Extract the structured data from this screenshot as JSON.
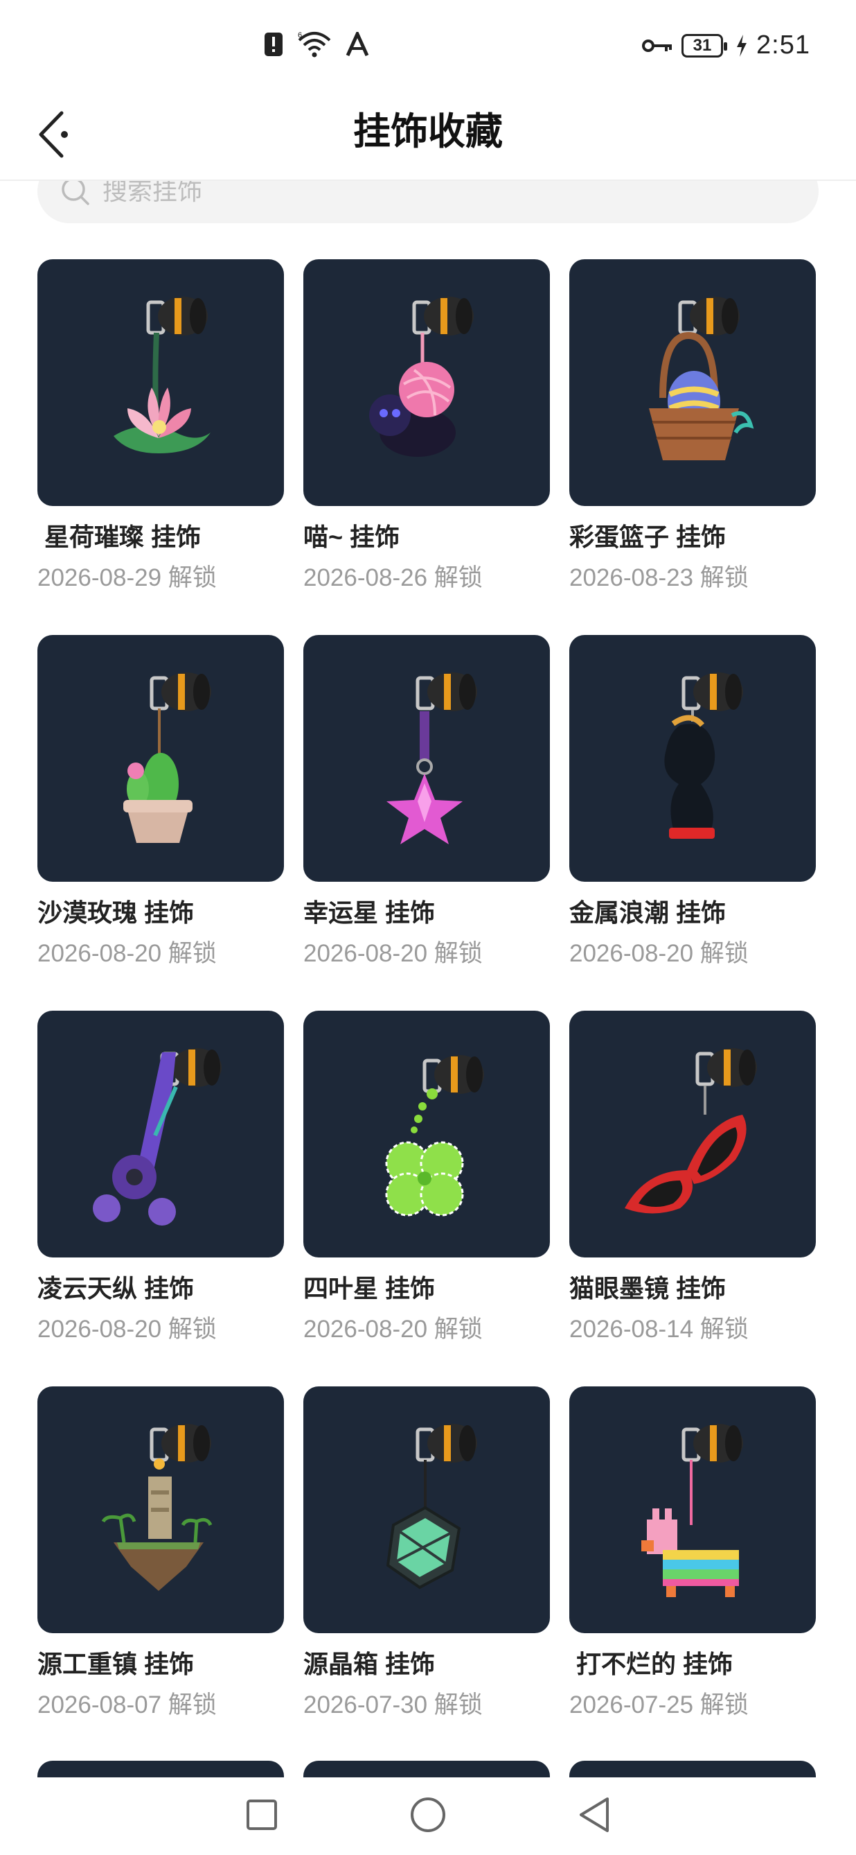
{
  "status_bar": {
    "time": "2:51",
    "battery": "31",
    "icons": [
      "notification-alert-icon",
      "wifi-6-icon",
      "app-a-icon",
      "key-icon",
      "battery-icon",
      "charging-icon"
    ]
  },
  "header": {
    "title": "挂饰收藏",
    "back_icon": "back-arrow-icon"
  },
  "search": {
    "placeholder": "搜索挂饰"
  },
  "items": [
    {
      "name": " 星荷璀璨 挂饰",
      "date": "2026-08-29 解锁",
      "art": "lotus"
    },
    {
      "name": "喵~ 挂饰",
      "date": "2026-08-26 解锁",
      "art": "yarn-cat"
    },
    {
      "name": "彩蛋篮子 挂饰",
      "date": "2026-08-23 解锁",
      "art": "egg-basket"
    },
    {
      "name": "沙漠玫瑰 挂饰",
      "date": "2026-08-20 解锁",
      "art": "cactus"
    },
    {
      "name": "幸运星 挂饰",
      "date": "2026-08-20 解锁",
      "art": "star"
    },
    {
      "name": "金属浪潮 挂饰",
      "date": "2026-08-20 解锁",
      "art": "chess-knight"
    },
    {
      "name": "凌云天纵 挂饰",
      "date": "2026-08-20 解锁",
      "art": "spinner"
    },
    {
      "name": "四叶星 挂饰",
      "date": "2026-08-20 解锁",
      "art": "clover"
    },
    {
      "name": "猫眼墨镜 挂饰",
      "date": "2026-08-14 解锁",
      "art": "sunglasses"
    },
    {
      "name": "源工重镇 挂饰",
      "date": "2026-08-07 解锁",
      "art": "floating-island"
    },
    {
      "name": "源晶箱 挂饰",
      "date": "2026-07-30 解锁",
      "art": "crystal-box"
    },
    {
      "name": " 打不烂的 挂饰",
      "date": "2026-07-25 解锁",
      "art": "pinata"
    }
  ],
  "colors": {
    "card_bg": "#1d2838",
    "date_text": "#9a9a9a",
    "search_bg": "#f3f3f3"
  }
}
